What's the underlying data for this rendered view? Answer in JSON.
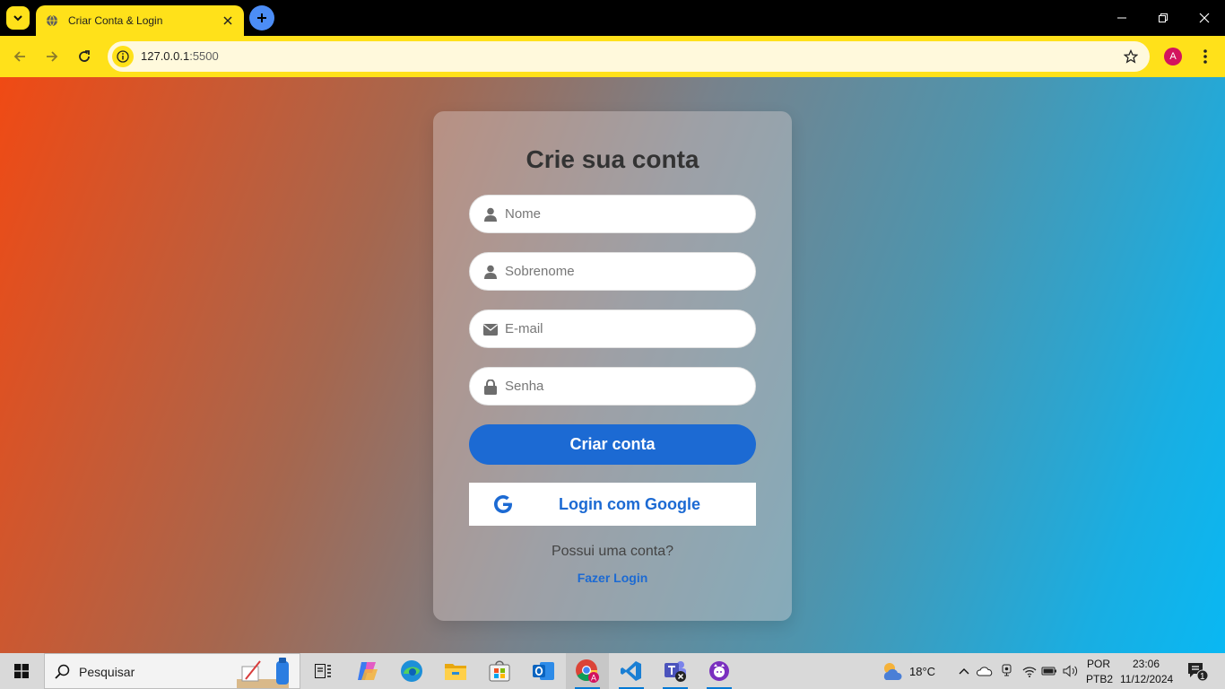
{
  "browser": {
    "tab_title": "Criar Conta & Login",
    "url_host": "127.0.0.1",
    "url_port": ":5500",
    "profile_initial": "A",
    "accent": "#ffe11a"
  },
  "signup": {
    "title": "Crie sua conta",
    "name_placeholder": "Nome",
    "surname_placeholder": "Sobrenome",
    "email_placeholder": "E-mail",
    "password_placeholder": "Senha",
    "submit_label": "Criar conta",
    "google_label": "Login com Google",
    "has_account_text": "Possui uma conta?",
    "login_link": "Fazer Login",
    "primary_color": "#1c6ad3"
  },
  "taskbar": {
    "search_label": "Pesquisar",
    "weather": "18°C",
    "language_line1": "POR",
    "language_line2": "PTB2",
    "time": "23:06",
    "date": "11/12/2024",
    "notification_count": "1",
    "apps": [
      "copilot-icon",
      "edge-icon",
      "file-explorer-icon",
      "store-icon",
      "outlook-icon",
      "chrome-icon",
      "vscode-icon",
      "teams-icon",
      "github-desktop-icon"
    ]
  }
}
